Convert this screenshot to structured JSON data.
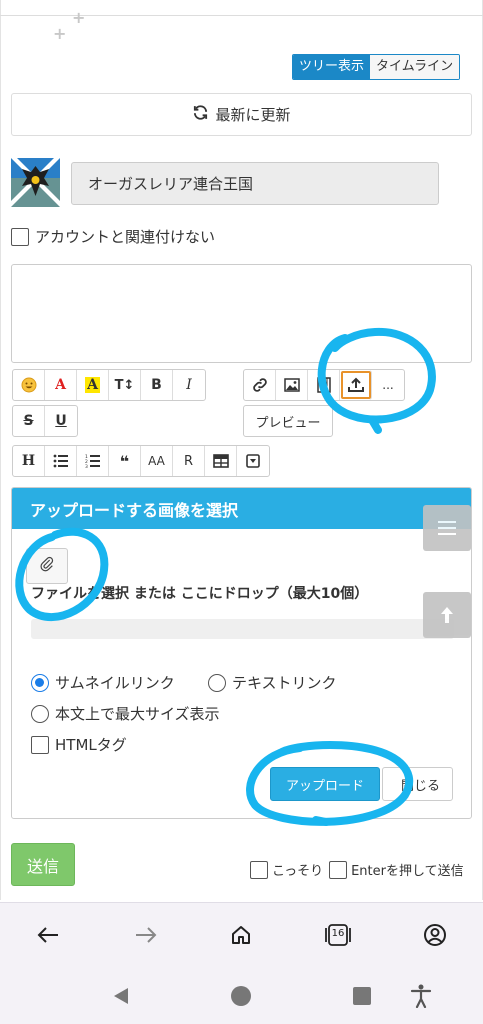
{
  "view_toggle": {
    "tree": "ツリー表示",
    "timeline": "タイムライン"
  },
  "refresh": {
    "label": "最新に更新"
  },
  "poster": {
    "name": "オーガスレリア連合王国"
  },
  "account_checkbox": {
    "label": "アカウントと関連付けない"
  },
  "toolbar": {
    "row1_left": [
      "emoji-icon",
      "A",
      "A",
      "T↕",
      "B",
      "I"
    ],
    "row1_right": [
      "link-icon",
      "image-icon",
      "film-icon",
      "upload-icon",
      "..."
    ],
    "strike": "S",
    "underline": "U",
    "preview": "プレビュー",
    "row3": [
      "H",
      "list-icon",
      "numbered-list-icon",
      "❝",
      "AA",
      "R",
      "table-icon",
      "dropdown-icon"
    ]
  },
  "upload_panel": {
    "title": "アップロードする画像を選択",
    "drop_text": "ファイルを選択 または ここにドロップ（最大10個）",
    "options": {
      "thumbnail": "サムネイルリンク",
      "text": "テキストリンク",
      "max_size": "本文上で最大サイズ表示",
      "html": "HTMLタグ"
    },
    "upload_button": "アップロード",
    "close_button": "閉じる"
  },
  "send": {
    "label": "送信"
  },
  "secret": {
    "label": "こっそり"
  },
  "enter_send": {
    "label": "Enterを押して送信"
  },
  "browser": {
    "tab_count": "16"
  },
  "colors": {
    "accent": "#2aaee3",
    "send": "#7fc86b",
    "annotation": "#18b5ef"
  }
}
